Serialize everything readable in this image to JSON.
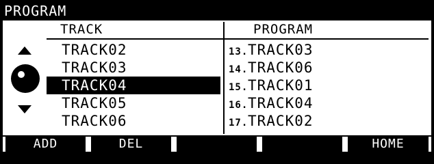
{
  "screen": {
    "title": "PROGRAM"
  },
  "columns": {
    "track_header": "TRACK",
    "program_header": "PROGRAM"
  },
  "track_list": [
    {
      "label": "TRACK02",
      "selected": false
    },
    {
      "label": "TRACK03",
      "selected": false
    },
    {
      "label": "TRACK04",
      "selected": true
    },
    {
      "label": "TRACK05",
      "selected": false
    },
    {
      "label": "TRACK06",
      "selected": false
    }
  ],
  "program_list": [
    {
      "num": "13.",
      "label": "TRACK03"
    },
    {
      "num": "14.",
      "label": "TRACK06"
    },
    {
      "num": "15.",
      "label": "TRACK01"
    },
    {
      "num": "16.",
      "label": "TRACK04"
    },
    {
      "num": "17.",
      "label": "TRACK02"
    }
  ],
  "function_keys": [
    {
      "label": "ADD"
    },
    {
      "label": "DEL"
    },
    {
      "label": ""
    },
    {
      "label": ""
    },
    {
      "label": "HOME"
    }
  ],
  "icons": {
    "scroll_up": "triangle-up-icon",
    "scroll_down": "triangle-down-icon",
    "jog": "jog-wheel-icon"
  }
}
